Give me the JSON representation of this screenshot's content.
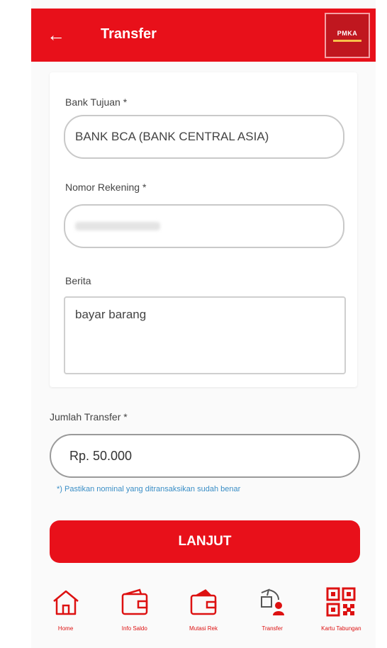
{
  "header": {
    "back_icon": "arrow-left-icon",
    "title": "Transfer",
    "logo_text": "PMKA"
  },
  "form": {
    "bank_label": "Bank Tujuan *",
    "bank_value": "BANK BCA (BANK CENTRAL ASIA)",
    "account_label": "Nomor Rekening *",
    "account_value": "",
    "message_label": "Berita",
    "message_value": "bayar barang"
  },
  "amount": {
    "label": "Jumlah Transfer *",
    "value": "Rp. 50.000",
    "note": "*) Pastikan nominal yang ditransaksikan sudah benar"
  },
  "submit_label": "LANJUT",
  "nav": {
    "items": [
      {
        "label": "Home",
        "icon": "home-icon"
      },
      {
        "label": "Info Saldo",
        "icon": "wallet-icon"
      },
      {
        "label": "Mutasi Rek",
        "icon": "wallet-card-icon"
      },
      {
        "label": "Transfer",
        "icon": "transfer-icon"
      },
      {
        "label": "Kartu Tabungan",
        "icon": "qr-code-icon"
      }
    ]
  },
  "colors": {
    "primary": "#e8101a",
    "note": "#3a8ec6"
  }
}
